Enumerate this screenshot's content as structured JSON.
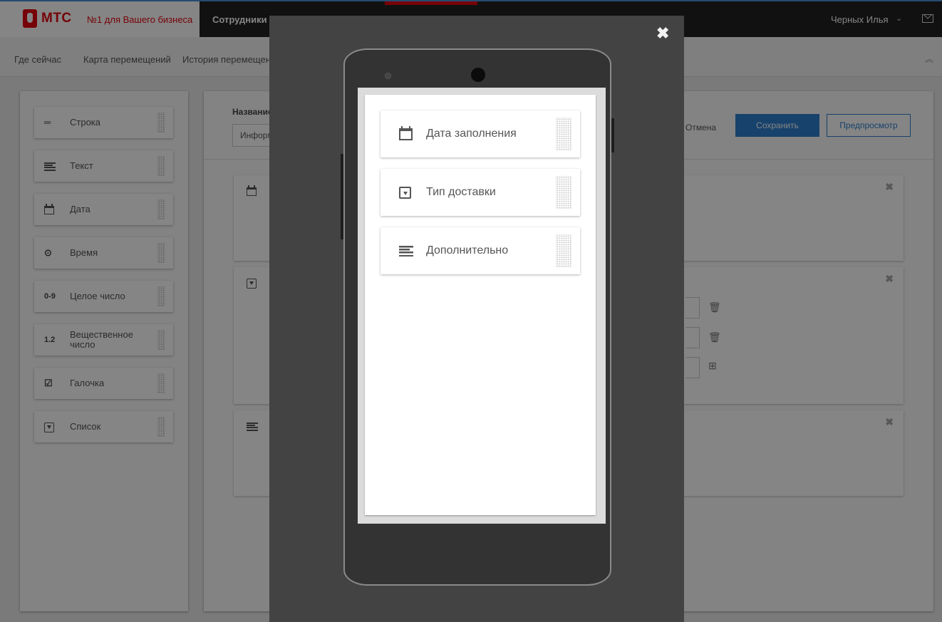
{
  "header": {
    "logo_text": "МТС",
    "slogan": "№1 для Вашего бизнеса",
    "nav_item": "Сотрудники",
    "user_name": "Черных Илья",
    "user_chevron": "⌄",
    "colors": {
      "brand_red": "#e30611",
      "header_bg": "#222222",
      "accent_blue": "#2d7fd0"
    }
  },
  "subnav": {
    "items": [
      "Где сейчас",
      "Карта перемещений",
      "История перемещений"
    ],
    "collapse_icon": "chevrons-up-icon"
  },
  "palette": {
    "items": [
      {
        "icon": "—",
        "label": "Строка"
      },
      {
        "icon": "lines",
        "label": "Текст"
      },
      {
        "icon": "calendar",
        "label": "Дата"
      },
      {
        "icon": "⊙",
        "label": "Время"
      },
      {
        "icon": "0-9",
        "label": "Целое число"
      },
      {
        "icon": "1.2",
        "label": "Вещественное число"
      },
      {
        "icon": "☑",
        "label": "Галочка"
      },
      {
        "icon": "select",
        "label": "Список"
      }
    ]
  },
  "form": {
    "name_label": "Название",
    "name_value": "Информация",
    "cancel_label": "Отмена",
    "save_label": "Сохранить",
    "preview_label": "Предпросмотр"
  },
  "modal": {
    "close_glyph": "✖",
    "preview_fields": [
      {
        "icon": "calendar-icon",
        "label": "Дата заполнения"
      },
      {
        "icon": "dropdown-icon",
        "label": "Тип доставки"
      },
      {
        "icon": "text-lines-icon",
        "label": "Дополнительно"
      }
    ]
  }
}
